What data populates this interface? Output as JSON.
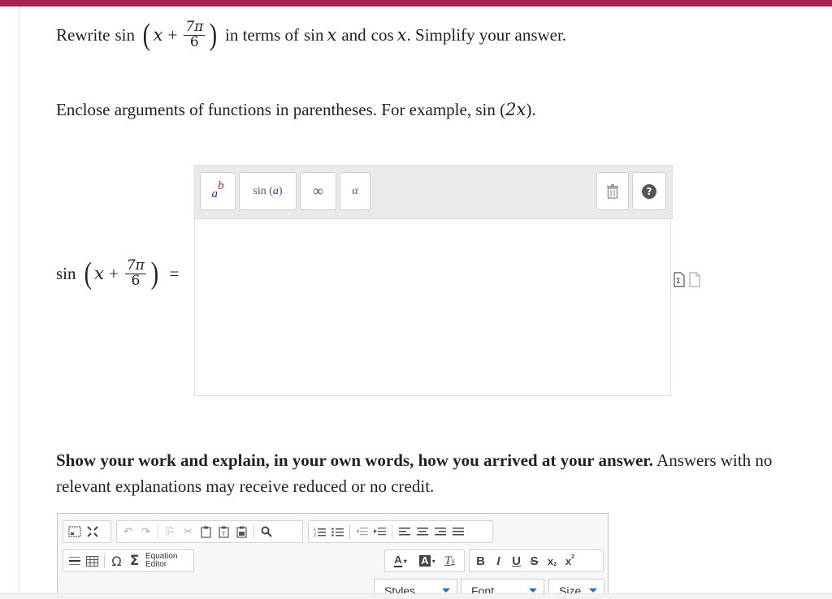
{
  "question": {
    "rewrite_word": "Rewrite",
    "func": "sin",
    "var": "x",
    "plus": "+",
    "frac_num": "7π",
    "frac_den": "6",
    "tail_in_terms": "in terms of",
    "sin_x": "sin",
    "and_word": "and",
    "cos_x": "cos",
    "tail_end": ". Simplify your answer."
  },
  "hint": {
    "text_before": "Enclose arguments of functions in parentheses. For example,",
    "example_func": "sin",
    "example_arg": "2x",
    "end": "."
  },
  "equation_toolbar": {
    "power_base": "a",
    "power_exp": "b",
    "sin_func": "sin",
    "sin_arg": "a",
    "infinity": "∞",
    "alpha": "α",
    "trash_icon": "trash-icon",
    "help": "?"
  },
  "answer_lhs": {
    "func": "sin",
    "var": "x",
    "plus": "+",
    "frac_num": "7π",
    "frac_den": "6",
    "equals": "="
  },
  "work_prompt": {
    "bold": "Show your work and explain, in your own words, how you arrived at your answer.",
    "normal": " Answers with no relevant explanations may receive reduced or no credit."
  },
  "editor": {
    "equation_editor_line1": "Equation",
    "equation_editor_line2": "Editor",
    "omega": "Ω",
    "sigma": "Σ",
    "styles": "Styles",
    "font": "Font",
    "size": "Size",
    "bold": "B",
    "italic": "I",
    "underline": "U",
    "strike": "S",
    "font_color": "A",
    "bg_color": "A",
    "remove_format": "T"
  },
  "colors": {
    "accent": "#a8204f",
    "math_blue": "#1b33b0",
    "dropdown_caret": "#1a6fc0"
  }
}
